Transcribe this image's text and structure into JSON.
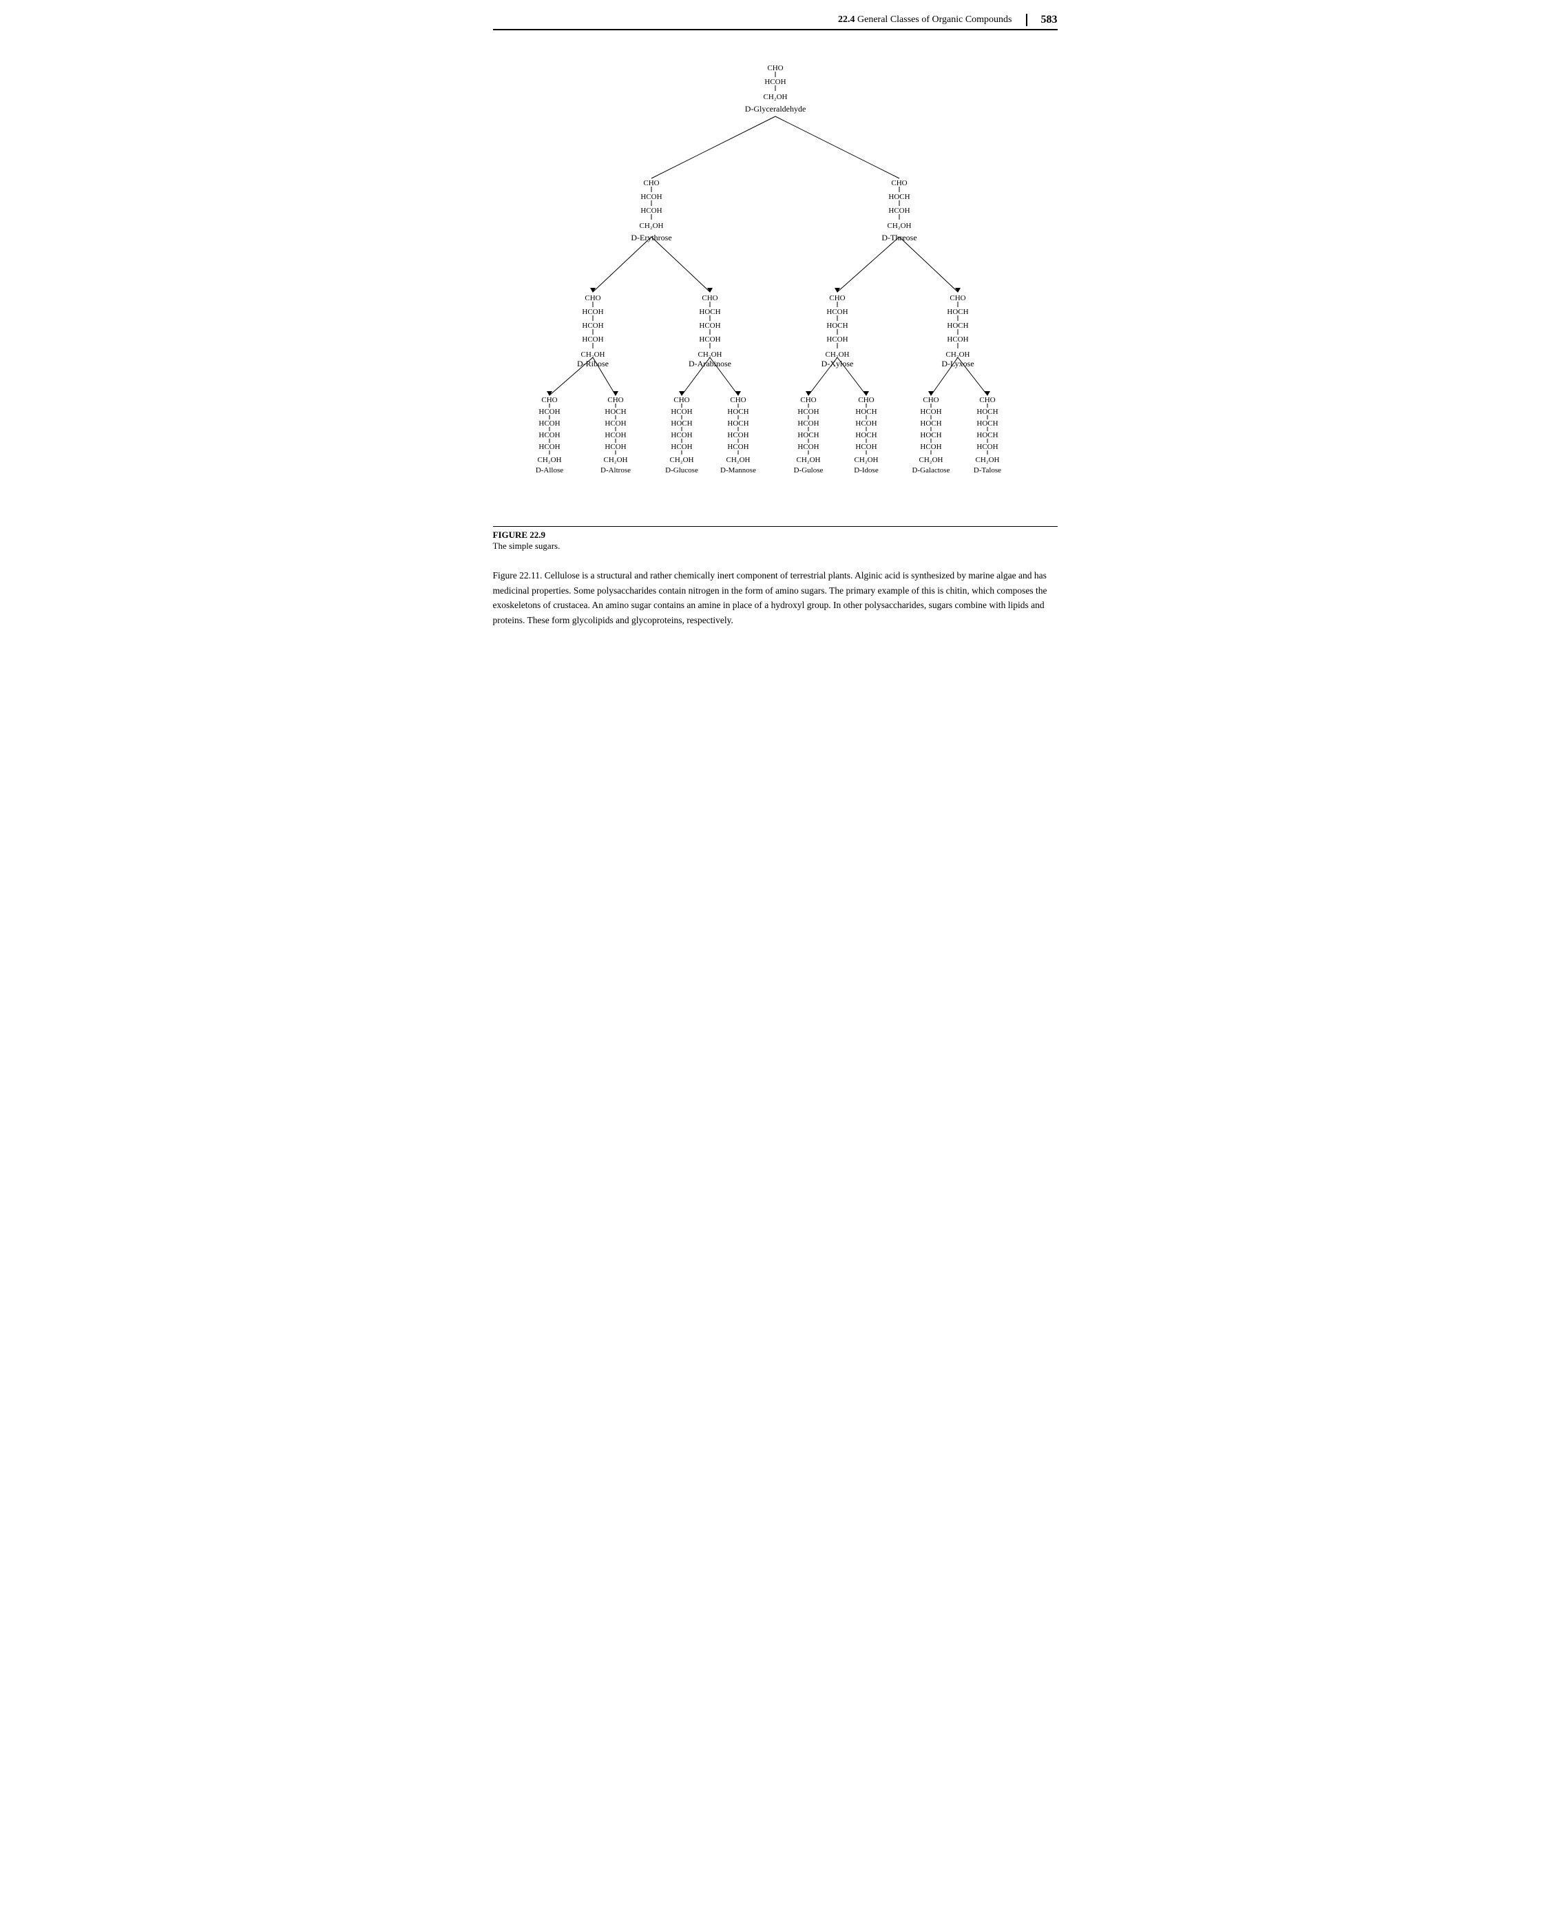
{
  "header": {
    "section_num": "22.4",
    "section_title": "General Classes of Organic Compounds",
    "page_number": "583"
  },
  "figure": {
    "label": "FIGURE 22.9",
    "caption": "The simple sugars."
  },
  "body_text": "Figure 22.11. Cellulose is a structural and rather chemically inert component of terrestrial plants. Alginic acid is synthesized by marine algae and has medicinal properties. Some polysaccharides contain nitrogen in the form of amino sugars. The primary example of this is chitin, which composes the exoskeletons of crustacea. An amino sugar contains an amine in place of a hydroxyl group. In other polysaccharides, sugars combine with lipids and proteins. These form glycolipids and glycoproteins, respectively.",
  "tree": {
    "root": "D-Glyceraldehyde",
    "level1_left": "D-Erythrose",
    "level1_right": "D-Threose",
    "level2": [
      "D-Ribose",
      "D-Arabinose",
      "D-Xylose",
      "D-Lyxose"
    ],
    "level3": [
      "D-Allose",
      "D-Altrose",
      "D-Glucose",
      "D-Mannose",
      "D-Gulose",
      "D-Idose",
      "D-Galactose",
      "D-Talose"
    ]
  }
}
